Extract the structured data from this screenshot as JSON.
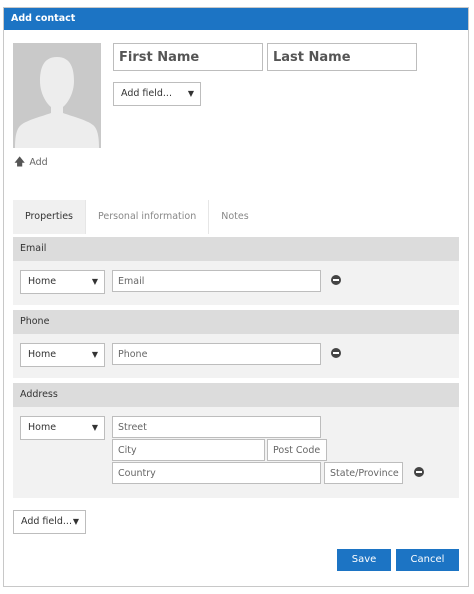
{
  "dialog": {
    "title": "Add contact"
  },
  "photo": {
    "add_label": "Add",
    "add_icon": "up-arrow-icon"
  },
  "name": {
    "first_placeholder": "First Name",
    "last_placeholder": "Last Name",
    "first_value": "",
    "last_value": ""
  },
  "add_field_top": {
    "label": "Add field..."
  },
  "tabs": [
    {
      "label": "Properties",
      "active": true
    },
    {
      "label": "Personal information",
      "active": false
    },
    {
      "label": "Notes",
      "active": false
    }
  ],
  "email": {
    "heading": "Email",
    "type_value": "Home",
    "placeholder": "Email"
  },
  "phone": {
    "heading": "Phone",
    "type_value": "Home",
    "placeholder": "Phone"
  },
  "address": {
    "heading": "Address",
    "type_value": "Home",
    "street_placeholder": "Street",
    "city_placeholder": "City",
    "postcode_placeholder": "Post Code",
    "country_placeholder": "Country",
    "state_placeholder": "State/Province"
  },
  "add_field_bottom": {
    "label": "Add field..."
  },
  "buttons": {
    "save": "Save",
    "cancel": "Cancel"
  },
  "colors": {
    "accent": "#1c74c4",
    "section_header": "#dcdcdc",
    "section_body": "#f2f2f2"
  }
}
